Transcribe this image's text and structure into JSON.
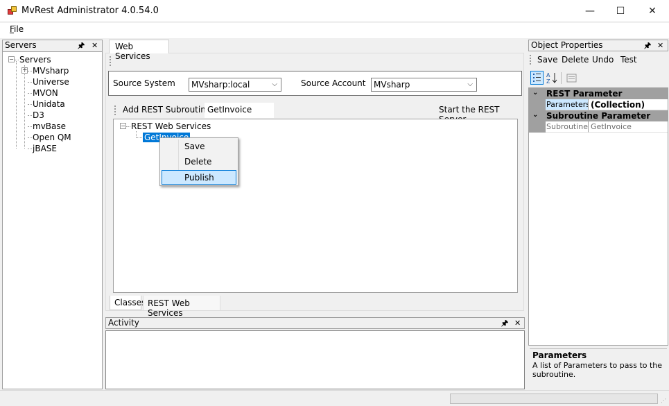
{
  "window": {
    "title": "MvRest Administrator 4.0.54.0",
    "minimize": "—",
    "maximize": "☐",
    "close": "✕"
  },
  "menu": {
    "file_hotkey": "F",
    "file_rest": "ile"
  },
  "servers": {
    "header": "Servers",
    "pin": "🖈",
    "close": "✕",
    "root": "Servers",
    "expander": "+",
    "items": [
      "MVsharp",
      "Universe",
      "MVON",
      "Unidata",
      "D3",
      "mvBase",
      "Open QM",
      "jBASE"
    ]
  },
  "doc": {
    "tab": "Web Services"
  },
  "source": {
    "system_label": "Source System",
    "system_value": "MVsharp:local",
    "account_label": "Source Account",
    "account_value": "MVsharp"
  },
  "rest_toolbar": {
    "add_label": "Add REST Subroutine",
    "add_value": "GetInvoice",
    "start_label": "Start the REST Server"
  },
  "rest_tree": {
    "root": "REST Web Services",
    "child": "GetInvoice",
    "expander": "−"
  },
  "context_menu": {
    "items": [
      "Save",
      "Delete",
      "Publish"
    ],
    "selected": "Publish"
  },
  "bottom_tabs": [
    "Classes",
    "REST Web Services"
  ],
  "activity": {
    "header": "Activity",
    "pin": "🖈",
    "close": "✕"
  },
  "properties": {
    "header": "Object Properties",
    "pin": "🖈",
    "close": "✕",
    "toolbar": [
      "Save",
      "Delete",
      "Undo",
      "Test"
    ],
    "categories": [
      {
        "name": "REST Parameter",
        "rows": [
          {
            "key": "Parameters",
            "value": "(Collection)"
          }
        ]
      },
      {
        "name": "Subroutine Parameter",
        "rows": [
          {
            "key": "SubroutineN",
            "value": "GetInvoice"
          }
        ]
      }
    ],
    "desc_title": "Parameters",
    "desc_text": "A list of Parameters to pass to the subroutine."
  },
  "colors": {
    "accent": "#0078d7",
    "selection": "#cce8ff",
    "category": "#a0a0a0"
  }
}
